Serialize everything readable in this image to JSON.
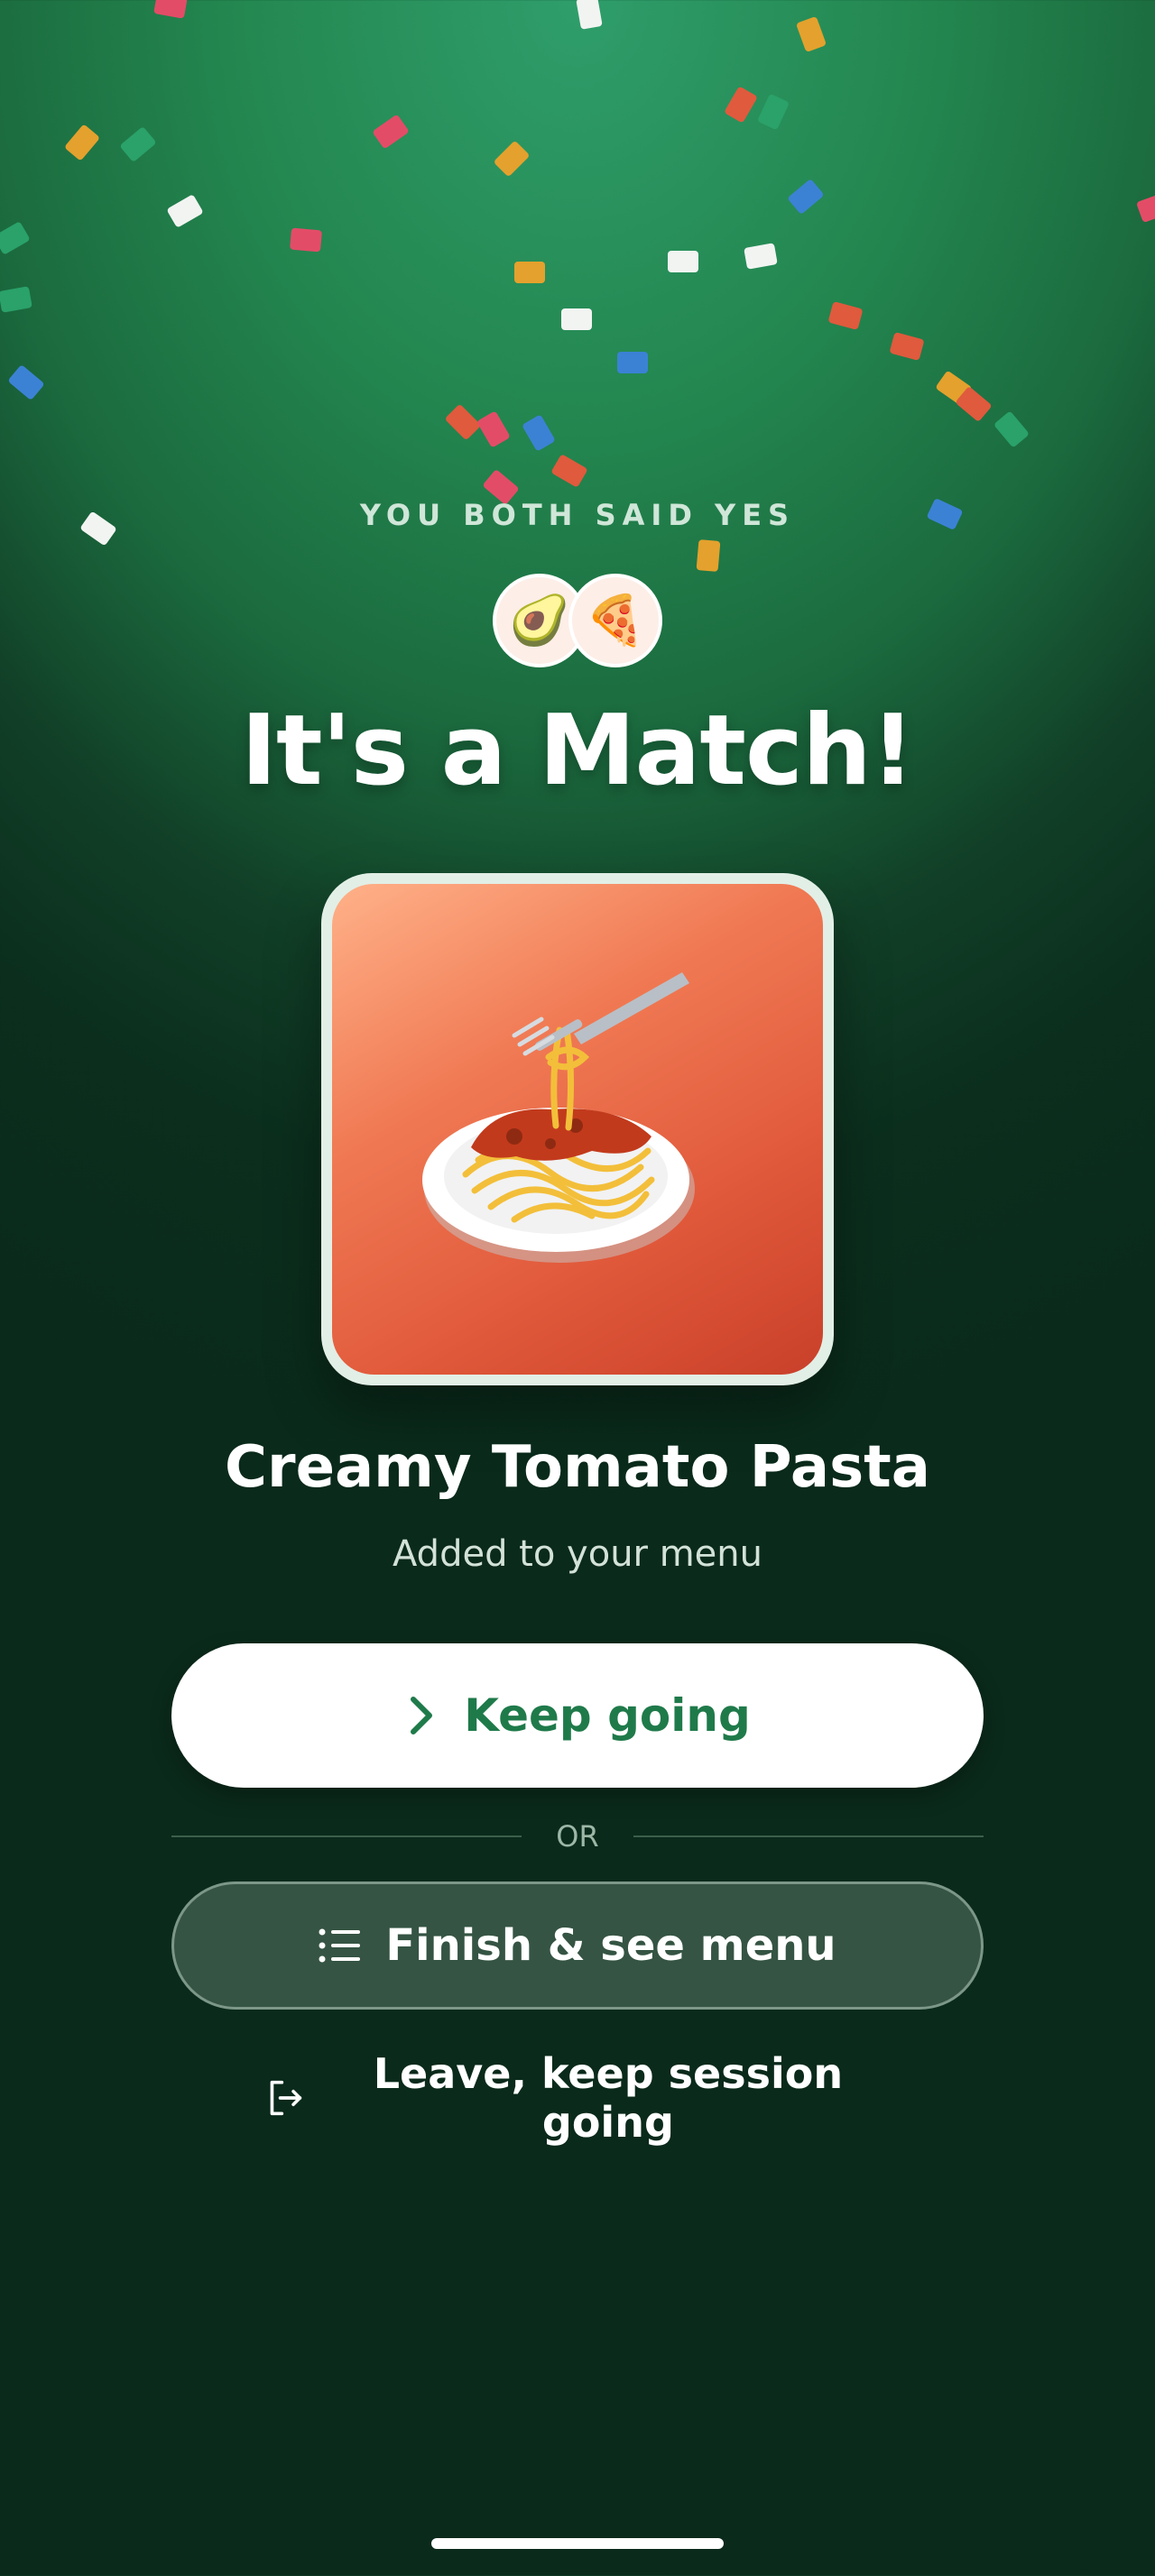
{
  "eyebrow": "YOU BOTH SAID YES",
  "avatars": [
    {
      "icon": "avocado-icon",
      "glyph": "🥑"
    },
    {
      "icon": "pizza-icon",
      "glyph": "🍕"
    }
  ],
  "title": "It's a Match!",
  "dish": {
    "image_icon": "spaghetti-icon",
    "name": "Creamy Tomato Pasta",
    "subtitle": "Added to your menu"
  },
  "actions": {
    "keep_going": "Keep going",
    "or": "OR",
    "finish": "Finish & see menu",
    "leave": "Leave, keep session going"
  },
  "colors": {
    "accent_green": "#1f7a4a",
    "background_top": "#2f9e6b",
    "background_bottom": "#0a2a1b"
  }
}
